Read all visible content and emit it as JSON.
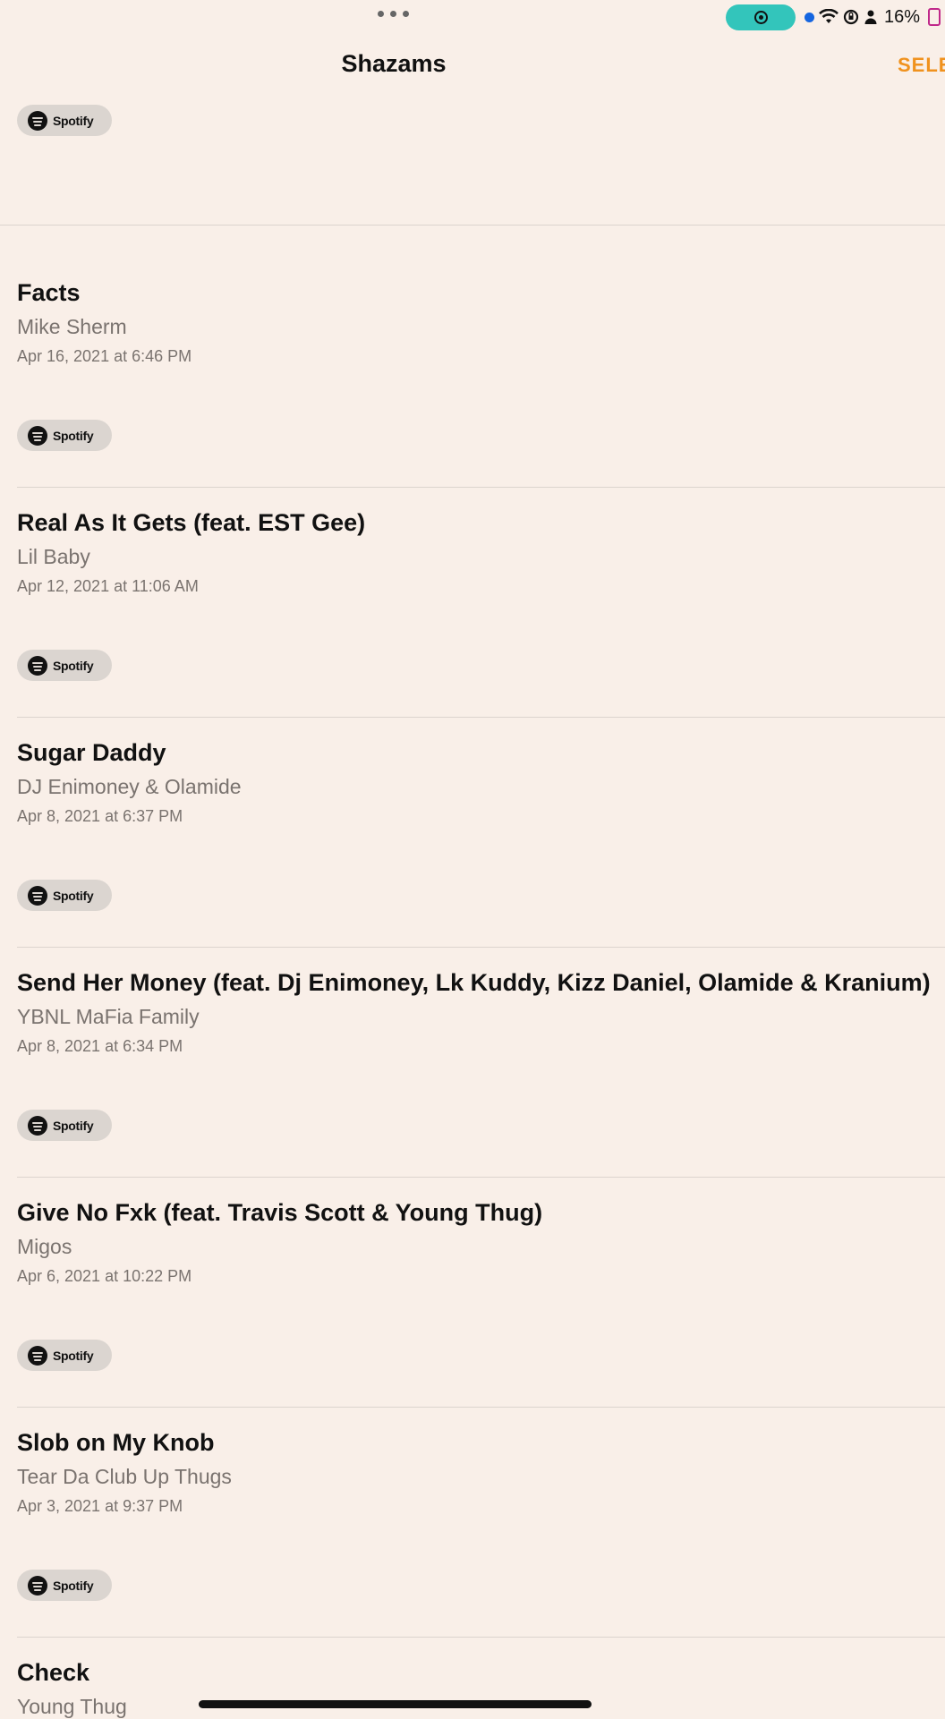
{
  "status_bar": {
    "battery_percent": "16%",
    "recording_indicator": "screen-record-icon",
    "icons": [
      "wifi-icon",
      "rotation-lock-icon",
      "person-icon"
    ],
    "accent": "#33c5bb"
  },
  "nav": {
    "title": "Shazams",
    "select_label": "SELE",
    "select_color": "#f0921e"
  },
  "spotify_label": "Spotify",
  "songs": [
    {
      "title": "Facts",
      "artist": "Mike Sherm",
      "date": "Apr 16, 2021 at 6:46 PM"
    },
    {
      "title": "Real As It Gets (feat. EST Gee)",
      "artist": "Lil Baby",
      "date": "Apr 12, 2021 at 11:06 AM"
    },
    {
      "title": "Sugar Daddy",
      "artist": "DJ Enimoney & Olamide",
      "date": "Apr 8, 2021 at 6:37 PM"
    },
    {
      "title": "Send Her Money (feat. Dj Enimoney, Lk Kuddy, Kizz Daniel, Olamide & Kranium)",
      "artist": "YBNL MaFia Family",
      "date": "Apr 8, 2021 at 6:34 PM"
    },
    {
      "title": "Give No Fxk (feat. Travis Scott & Young Thug)",
      "artist": "Migos",
      "date": "Apr 6, 2021 at 10:22 PM"
    },
    {
      "title": "Slob on My Knob",
      "artist": "Tear Da Club Up Thugs",
      "date": "Apr 3, 2021 at 9:37 PM"
    },
    {
      "title": "Check",
      "artist": "Young Thug",
      "date": ""
    }
  ]
}
